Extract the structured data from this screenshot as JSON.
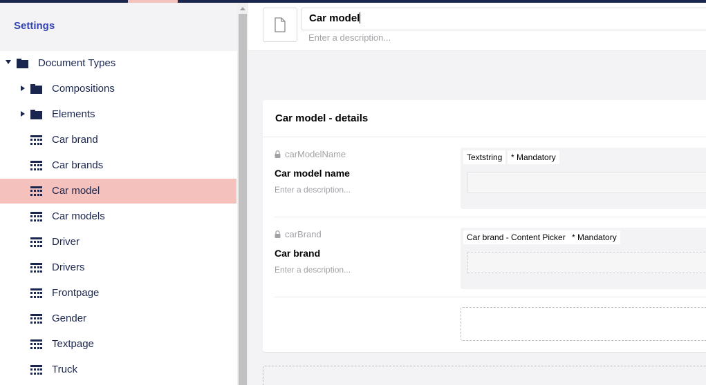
{
  "sidebar": {
    "title": "Settings",
    "items": [
      {
        "label": "Document Types",
        "type": "folder",
        "caret": "down",
        "level": 0
      },
      {
        "label": "Compositions",
        "type": "folder",
        "caret": "right",
        "level": 1
      },
      {
        "label": "Elements",
        "type": "folder",
        "caret": "right",
        "level": 1
      },
      {
        "label": "Car brand",
        "type": "doctype",
        "level": 1
      },
      {
        "label": "Car brands",
        "type": "doctype",
        "level": 1
      },
      {
        "label": "Car model",
        "type": "doctype",
        "level": 1,
        "active": true
      },
      {
        "label": "Car models",
        "type": "doctype",
        "level": 1
      },
      {
        "label": "Driver",
        "type": "doctype",
        "level": 1
      },
      {
        "label": "Drivers",
        "type": "doctype",
        "level": 1
      },
      {
        "label": "Frontpage",
        "type": "doctype",
        "level": 1
      },
      {
        "label": "Gender",
        "type": "doctype",
        "level": 1
      },
      {
        "label": "Textpage",
        "type": "doctype",
        "level": 1
      },
      {
        "label": "Truck",
        "type": "doctype",
        "level": 1
      }
    ]
  },
  "header": {
    "icon": "document-icon",
    "name_value": "Car model",
    "description_placeholder": "Enter a description..."
  },
  "group": {
    "title": "Car model - details",
    "properties": [
      {
        "alias": "carModelName",
        "name": "Car model name",
        "description_placeholder": "Enter a description...",
        "editor_tag": "Textstring",
        "mandatory_tag": "* Mandatory"
      },
      {
        "alias": "carBrand",
        "name": "Car brand",
        "description_placeholder": "Enter a description...",
        "editor_tag": "Car brand - Content Picker",
        "mandatory_tag": "* Mandatory"
      }
    ]
  },
  "colors": {
    "brand_dark": "#1b264f",
    "active_item": "#f5c1bc",
    "settings_title": "#3544b1",
    "muted_text": "#a2a1a6"
  }
}
